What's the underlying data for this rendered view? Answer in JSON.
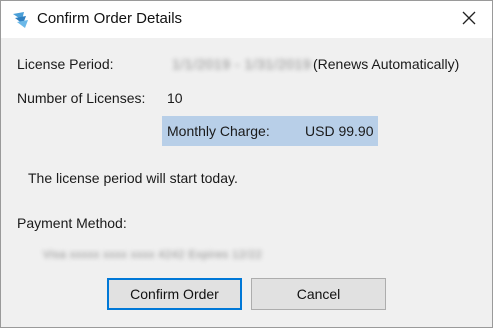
{
  "window": {
    "title": "Confirm Order Details",
    "close_glyph": "✕"
  },
  "details": {
    "license_period_label": "License Period:",
    "license_period_value": "1/1/2019 - 1/31/2019",
    "license_period_suffix": "(Renews Automatically)",
    "num_licenses_label": "Number of Licenses:",
    "num_licenses_value": "10",
    "monthly_charge_label": "Monthly Charge:",
    "monthly_charge_value": "USD 99.90",
    "start_notice": "The license period will start today.",
    "payment_method_label": "Payment Method:",
    "payment_method_value": "Visa xxxxx xxxx xxxx 4242 Expires 12/22"
  },
  "buttons": {
    "confirm_label": "Confirm Order",
    "cancel_label": "Cancel"
  },
  "colors": {
    "accent": "#0078d7",
    "highlight": "#b8cfe8"
  },
  "icons": {
    "app": "app-logo-icon",
    "close": "close-icon"
  }
}
